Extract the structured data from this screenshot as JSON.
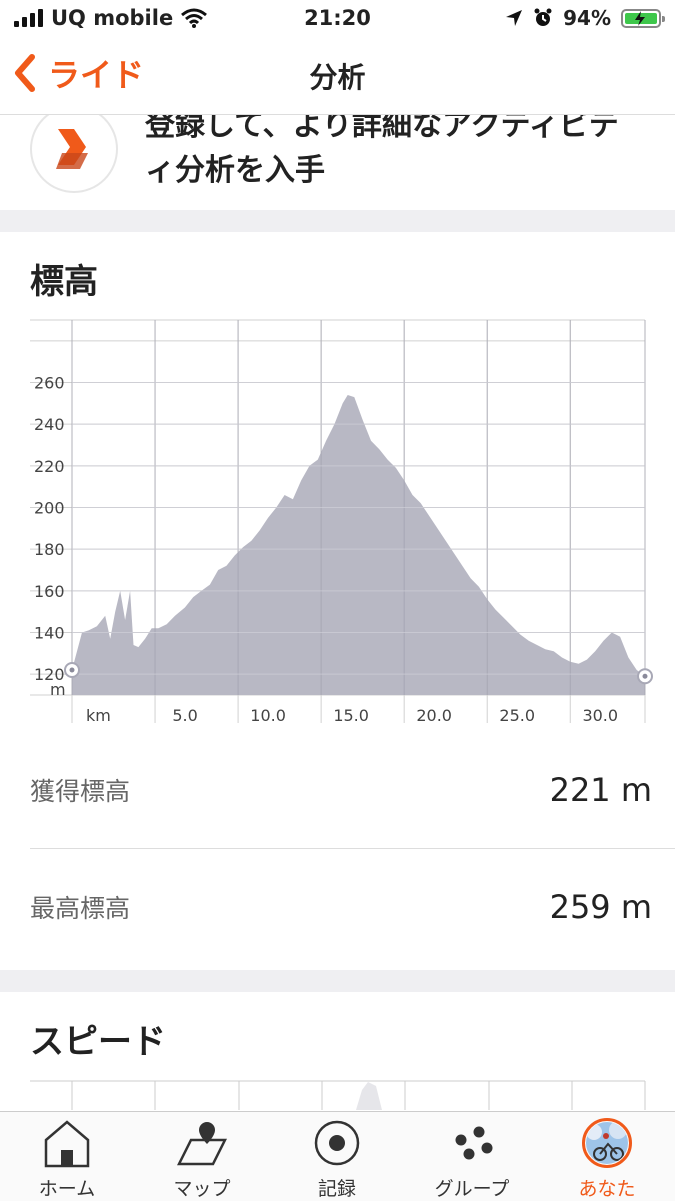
{
  "status_bar": {
    "carrier": "UQ mobile",
    "time": "21:20",
    "battery": "94%",
    "battery_color": "#3ec74b"
  },
  "nav": {
    "back_label": "ライド",
    "title": "分析",
    "accent": "#f05a1a"
  },
  "promo": {
    "line1": "登録して、より詳細なアクティビテ",
    "line2": "ィ分析を入手"
  },
  "elevation": {
    "title": "標高",
    "stats": [
      {
        "label": "獲得標高",
        "value": "221 m"
      },
      {
        "label": "最高標高",
        "value": "259 m"
      }
    ]
  },
  "speed": {
    "title": "スピード"
  },
  "chart_data": {
    "type": "area",
    "xlabel": "km",
    "ylabel": "m",
    "xlim": [
      0,
      34.5
    ],
    "ylim": [
      110,
      290
    ],
    "xticks": [
      "5.0",
      "10.0",
      "15.0",
      "20.0",
      "25.0",
      "30.0"
    ],
    "yticks": [
      "120",
      "140",
      "160",
      "180",
      "200",
      "220",
      "240",
      "260"
    ],
    "x": [
      0,
      0.3,
      0.6,
      1.0,
      1.5,
      2.0,
      2.3,
      2.6,
      2.9,
      3.2,
      3.5,
      3.7,
      4.0,
      4.4,
      4.8,
      5.2,
      5.7,
      6.2,
      6.8,
      7.3,
      7.8,
      8.3,
      8.8,
      9.3,
      9.8,
      10.3,
      10.8,
      11.3,
      11.8,
      12.3,
      12.8,
      13.3,
      13.8,
      14.3,
      14.8,
      15.3,
      15.8,
      16.3,
      16.6,
      17.0,
      17.5,
      18.0,
      18.5,
      19.0,
      19.5,
      20.0,
      20.5,
      21.0,
      21.5,
      22.0,
      22.5,
      23.0,
      23.5,
      24.0,
      24.5,
      25.0,
      25.5,
      26.0,
      26.5,
      27.0,
      27.5,
      28.0,
      28.5,
      29.0,
      29.5,
      30.0,
      30.5,
      31.0,
      31.5,
      32.0,
      32.5,
      33.0,
      33.5,
      34.0,
      34.5
    ],
    "y": [
      122,
      131,
      140,
      141,
      143,
      148,
      137,
      150,
      160,
      146,
      160,
      134,
      133,
      137,
      142,
      142,
      144,
      148,
      152,
      157,
      160,
      163,
      170,
      172,
      177,
      181,
      184,
      189,
      195,
      200,
      206,
      204,
      213,
      220,
      223,
      232,
      240,
      250,
      254,
      253,
      242,
      232,
      228,
      223,
      219,
      213,
      206,
      202,
      196,
      190,
      184,
      178,
      172,
      166,
      162,
      156,
      151,
      147,
      143,
      139,
      136,
      134,
      132,
      131,
      128,
      126,
      125,
      127,
      131,
      136,
      140,
      138,
      128,
      122,
      119
    ]
  }
}
